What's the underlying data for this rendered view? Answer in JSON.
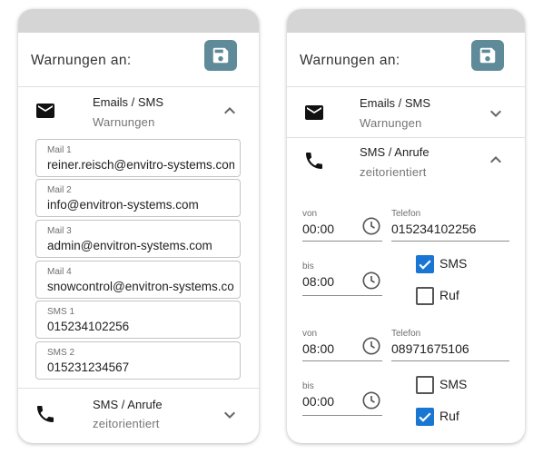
{
  "colors": {
    "accent": "#1976d2",
    "save_button": "#5f8a99",
    "header_bar": "#d5d5d5"
  },
  "left_panel": {
    "title": "Warnungen an:",
    "save_icon": "save-icon",
    "email_section": {
      "icon": "mail-icon",
      "title": "Emails / SMS",
      "subtitle": "Warnungen",
      "chevron": "chevron-up-icon",
      "fields": [
        {
          "label": "Mail 1",
          "value": "reiner.reisch@envitro-systems.com"
        },
        {
          "label": "Mail 2",
          "value": "info@envitron-systems.com"
        },
        {
          "label": "Mail 3",
          "value": "admin@envitron-systems.com"
        },
        {
          "label": "Mail 4",
          "value": "snowcontrol@envitron-systems.com"
        },
        {
          "label": "SMS 1",
          "value": "015234102256"
        },
        {
          "label": "SMS 2",
          "value": "015231234567"
        }
      ]
    },
    "phone_section": {
      "icon": "phone-icon",
      "title": "SMS / Anrufe",
      "subtitle": "zeitorientiert",
      "chevron": "chevron-down-icon"
    }
  },
  "right_panel": {
    "title": "Warnungen an:",
    "save_icon": "save-icon",
    "email_section": {
      "icon": "mail-icon",
      "title": "Emails / SMS",
      "subtitle": "Warnungen",
      "chevron": "chevron-down-icon"
    },
    "phone_section": {
      "icon": "phone-icon",
      "title": "SMS / Anrufe",
      "subtitle": "zeitorientiert",
      "chevron": "chevron-up-icon",
      "entries": [
        {
          "von_label": "von",
          "von_value": "00:00",
          "bis_label": "bis",
          "bis_value": "08:00",
          "phone_label": "Telefon",
          "phone_value": "015234102256",
          "sms_label": "SMS",
          "sms_checked": true,
          "ruf_label": "Ruf",
          "ruf_checked": false
        },
        {
          "von_label": "von",
          "von_value": "08:00",
          "bis_label": "bis",
          "bis_value": "00:00",
          "phone_label": "Telefon",
          "phone_value": "08971675106",
          "sms_label": "SMS",
          "sms_checked": false,
          "ruf_label": "Ruf",
          "ruf_checked": true
        }
      ]
    }
  }
}
